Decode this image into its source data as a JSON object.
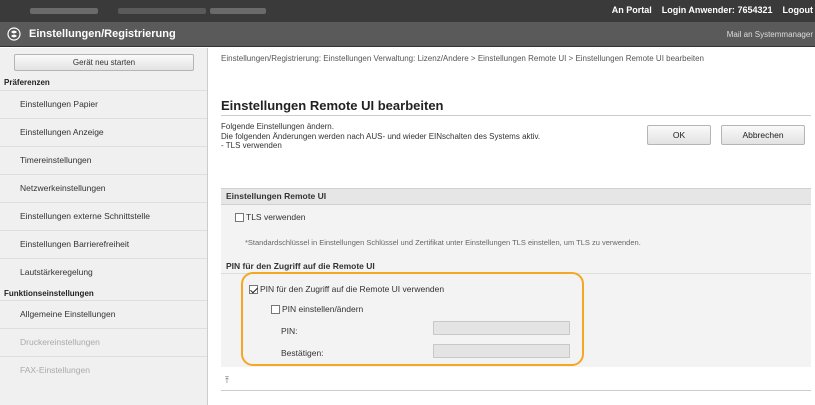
{
  "topbar": {
    "portal_link": "An Portal",
    "login_label": "Login Anwender:",
    "login_user": "7654321",
    "logout_link": "Logout"
  },
  "titlebar": {
    "title": "Einstellungen/Registrierung",
    "mail_link": "Mail an Systemmanager"
  },
  "sidebar": {
    "restart_button": "Gerät neu starten",
    "section_praeferenzen": "Präferenzen",
    "items_praeferenzen": [
      "Einstellungen Papier",
      "Einstellungen Anzeige",
      "Timereinstellungen",
      "Netzwerkeinstellungen",
      "Einstellungen externe Schnittstelle",
      "Einstellungen Barrierefreiheit",
      "Lautstärkeregelung"
    ],
    "section_funktion": "Funktionseinstellungen",
    "items_funktion": [
      "Allgemeine Einstellungen",
      "Druckereinstellungen",
      "FAX-Einstellungen"
    ]
  },
  "main": {
    "breadcrumb": "Einstellungen/Registrierung: Einstellungen Verwaltung: Lizenz/Andere > Einstellungen Remote UI > Einstellungen Remote UI bearbeiten",
    "page_title": "Einstellungen Remote UI bearbeiten",
    "info_line1": "Folgende Einstellungen ändern.",
    "info_line2": "Die folgenden Änderungen werden nach AUS- und wieder EINschalten des Systems aktiv.",
    "info_line3": "- TLS verwenden",
    "ok_button": "OK",
    "cancel_button": "Abbrechen",
    "section_remote_ui": "Einstellungen Remote UI",
    "tls_checkbox_label": "TLS verwenden",
    "tls_note": "*Standardschlüssel in Einstellungen Schlüssel und Zertifikat unter Einstellungen TLS einstellen, um TLS zu verwenden.",
    "pin_section_title": "PIN für den Zugriff auf die Remote UI",
    "pin_use_label": "PIN für den Zugriff auf die Remote UI verwenden",
    "pin_set_label": "PIN einstellen/ändern",
    "pin_label": "PIN:",
    "confirm_label": "Bestätigen:",
    "pin_value": "",
    "confirm_value": ""
  },
  "state": {
    "tls_checked": false,
    "pin_use_checked": true,
    "pin_set_checked": false
  },
  "colors": {
    "highlight": "#f5a623",
    "topbar": "#3a3a3a",
    "titlebar": "#5a5a5a"
  }
}
